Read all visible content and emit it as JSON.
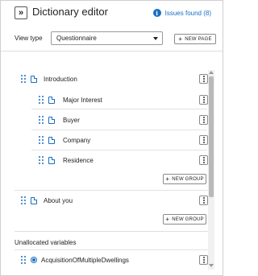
{
  "header": {
    "collapse_icon": "double-chevron-right-icon",
    "title": "Dictionary editor",
    "issues_label": "Issues found (8)",
    "issues_icon_glyph": "i",
    "accent_color": "#1a6ec2"
  },
  "view_type": {
    "label": "View type",
    "selected": "Questionnaire",
    "new_page_label": "NEW PAGE",
    "plus_glyph": "+"
  },
  "pages": [
    {
      "label": "Introduction",
      "groups": [
        "Major Interest",
        "Buyer",
        "Company",
        "Residence"
      ],
      "new_group_label": "NEW GROUP"
    },
    {
      "label": "About you",
      "groups": [],
      "new_group_label": "NEW GROUP"
    }
  ],
  "unallocated": {
    "title": "Unallocated variables",
    "items": [
      "AcquisitionOfMultipleDwellings"
    ]
  }
}
